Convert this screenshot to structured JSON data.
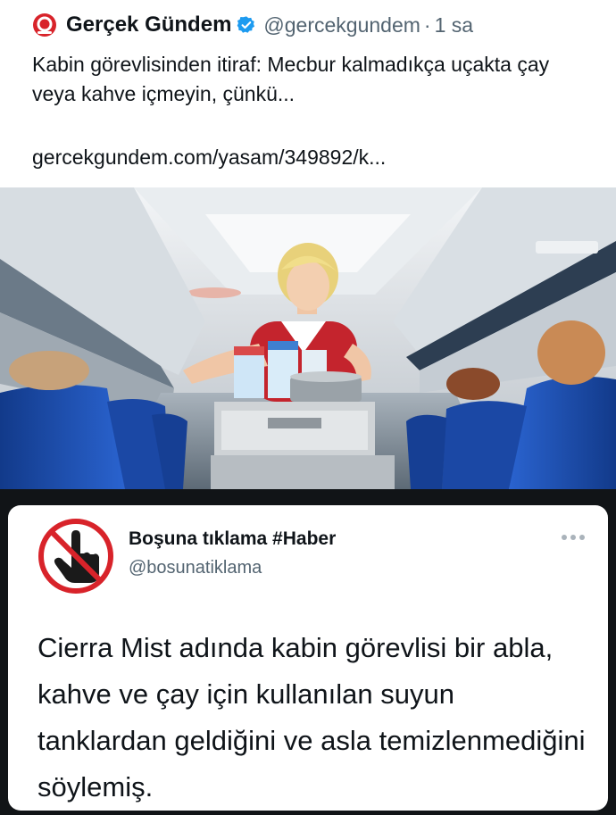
{
  "top_tweet": {
    "author_name": "Gerçek Gündem",
    "handle": "@gercekgundem",
    "separator": "·",
    "time": "1 sa",
    "text": "Kabin görevlisinden itiraf: Mecbur kalmadıkça uçakta çay veya kahve içmeyin, çünkü...",
    "link": "gercekgundem.com/yasam/349892/k...",
    "logo_icon": "gercek-gundem-logo-icon",
    "verified_icon": "verified-badge-icon",
    "photo": "flight-attendant-with-drinks-cart-photo"
  },
  "quote_tweet": {
    "author_name": "Boşuna tıklama #Haber",
    "handle": "@bosunatiklama",
    "text": "Cierra Mist adında kabin görevlisi bir abla, kahve ve çay için kullanılan suyun tanklardan geldiğini ve asla temizlenmediğini söylemiş.",
    "avatar_icon": "no-click-hand-icon",
    "more_icon": "more-options-icon"
  },
  "colors": {
    "brand_red": "#d8232a",
    "verified_blue": "#1d9bf0",
    "text_primary": "#0f1419",
    "text_secondary": "#536471",
    "frame_dark": "#111417",
    "seat_blue": "#1d4fb0"
  }
}
